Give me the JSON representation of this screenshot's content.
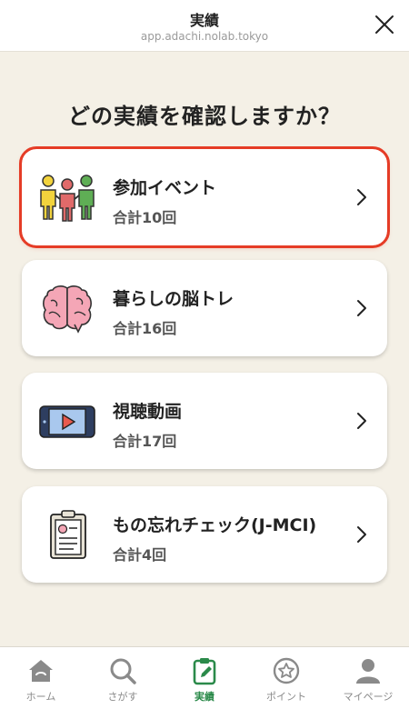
{
  "header": {
    "title": "実績",
    "url": "app.adachi.nolab.tokyo"
  },
  "question": "どの実績を確認しますか？",
  "cards": [
    {
      "icon": "people-icon",
      "name": "参加イベント",
      "count": "合計10回",
      "selected": true
    },
    {
      "icon": "brain-icon",
      "name": "暮らしの脳トレ",
      "count": "合計16回",
      "selected": false
    },
    {
      "icon": "video-icon",
      "name": "視聴動画",
      "count": "合計17回",
      "selected": false
    },
    {
      "icon": "clipboard-icon",
      "name": "もの忘れチェック(J-MCI)",
      "count": "合計4回",
      "selected": false
    }
  ],
  "tabs": [
    {
      "icon": "home-icon",
      "label": "ホーム",
      "active": false
    },
    {
      "icon": "search-icon",
      "label": "さがす",
      "active": false
    },
    {
      "icon": "records-icon",
      "label": "実績",
      "active": true
    },
    {
      "icon": "point-icon",
      "label": "ポイント",
      "active": false
    },
    {
      "icon": "person-icon",
      "label": "マイページ",
      "active": false
    }
  ],
  "colors": {
    "background": "#f4f0e6",
    "selected_outline": "#e53c26",
    "active_tab": "#2b8a4a"
  }
}
